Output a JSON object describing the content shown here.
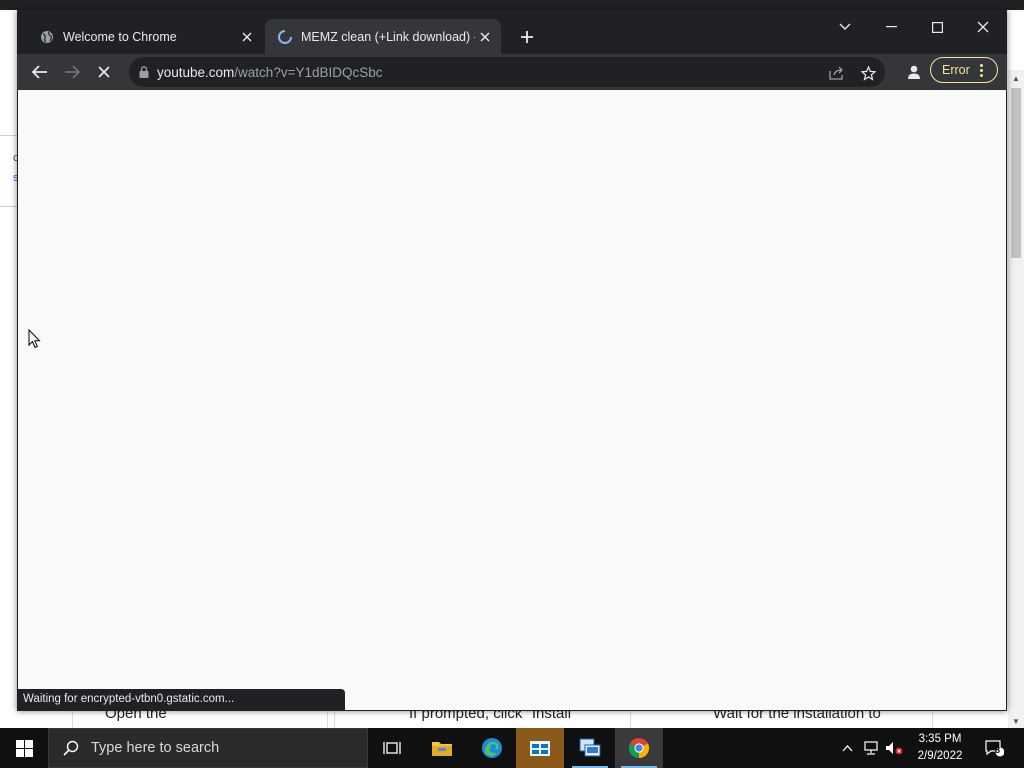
{
  "browser": {
    "tabs": [
      {
        "title": "Welcome to Chrome",
        "favicon": "globe-icon",
        "active": false
      },
      {
        "title": "MEMZ clean (+Link download) -",
        "favicon": "loading-spinner-icon",
        "active": true
      }
    ],
    "new_tab_icon": "plus-icon",
    "address": {
      "host": "youtube.com",
      "path": "/watch?v=Y1dBIDQcSbc"
    },
    "error_label": "Error",
    "status_text": "Waiting for encrypted-vtbn0.gstatic.com..."
  },
  "background_page": {
    "left_card_chars": [
      "c",
      "s"
    ],
    "steps": [
      "Open the",
      "If prompted, click \"Install",
      "Wait for the installation to"
    ]
  },
  "taskbar": {
    "search_placeholder": "Type here to search",
    "time": "3:35 PM",
    "date": "2/9/2022",
    "notification_count": "8",
    "apps": [
      "task-view-icon",
      "file-explorer-icon",
      "edge-icon",
      "store-icon",
      "remote-desktop-icon",
      "chrome-icon"
    ]
  },
  "colors": {
    "chrome_dark": "#202124",
    "toolbar": "#35363a",
    "error_accent": "#fde293",
    "taskbar": "#101010"
  }
}
